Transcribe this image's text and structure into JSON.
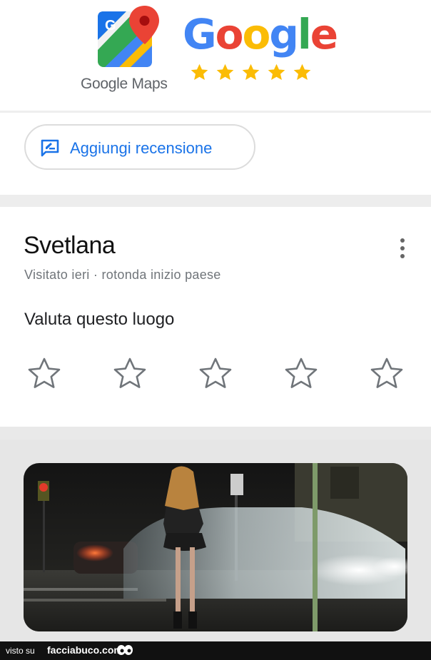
{
  "header": {
    "maps_label": "Google Maps",
    "google_letters": [
      {
        "ch": "G",
        "color": "#4285F4"
      },
      {
        "ch": "o",
        "color": "#EA4335"
      },
      {
        "ch": "o",
        "color": "#FBBC05"
      },
      {
        "ch": "g",
        "color": "#4285F4"
      },
      {
        "ch": "l",
        "color": "#34A853"
      },
      {
        "ch": "e",
        "color": "#EA4335"
      }
    ],
    "stars": 5,
    "star_color": "#FBBC05"
  },
  "add_review": {
    "label": "Aggiungi recensione",
    "icon": "rate-review-icon",
    "color": "#1a73e8"
  },
  "place": {
    "name": "Svetlana",
    "meta": "Visitato ieri · rotonda inizio paese",
    "rate_prompt": "Valuta questo luogo",
    "rating_max": 5,
    "rating_value": 0,
    "more_icon": "more-vert-icon"
  },
  "footer": {
    "visto": "visto su",
    "site": "facciabuco.com"
  }
}
